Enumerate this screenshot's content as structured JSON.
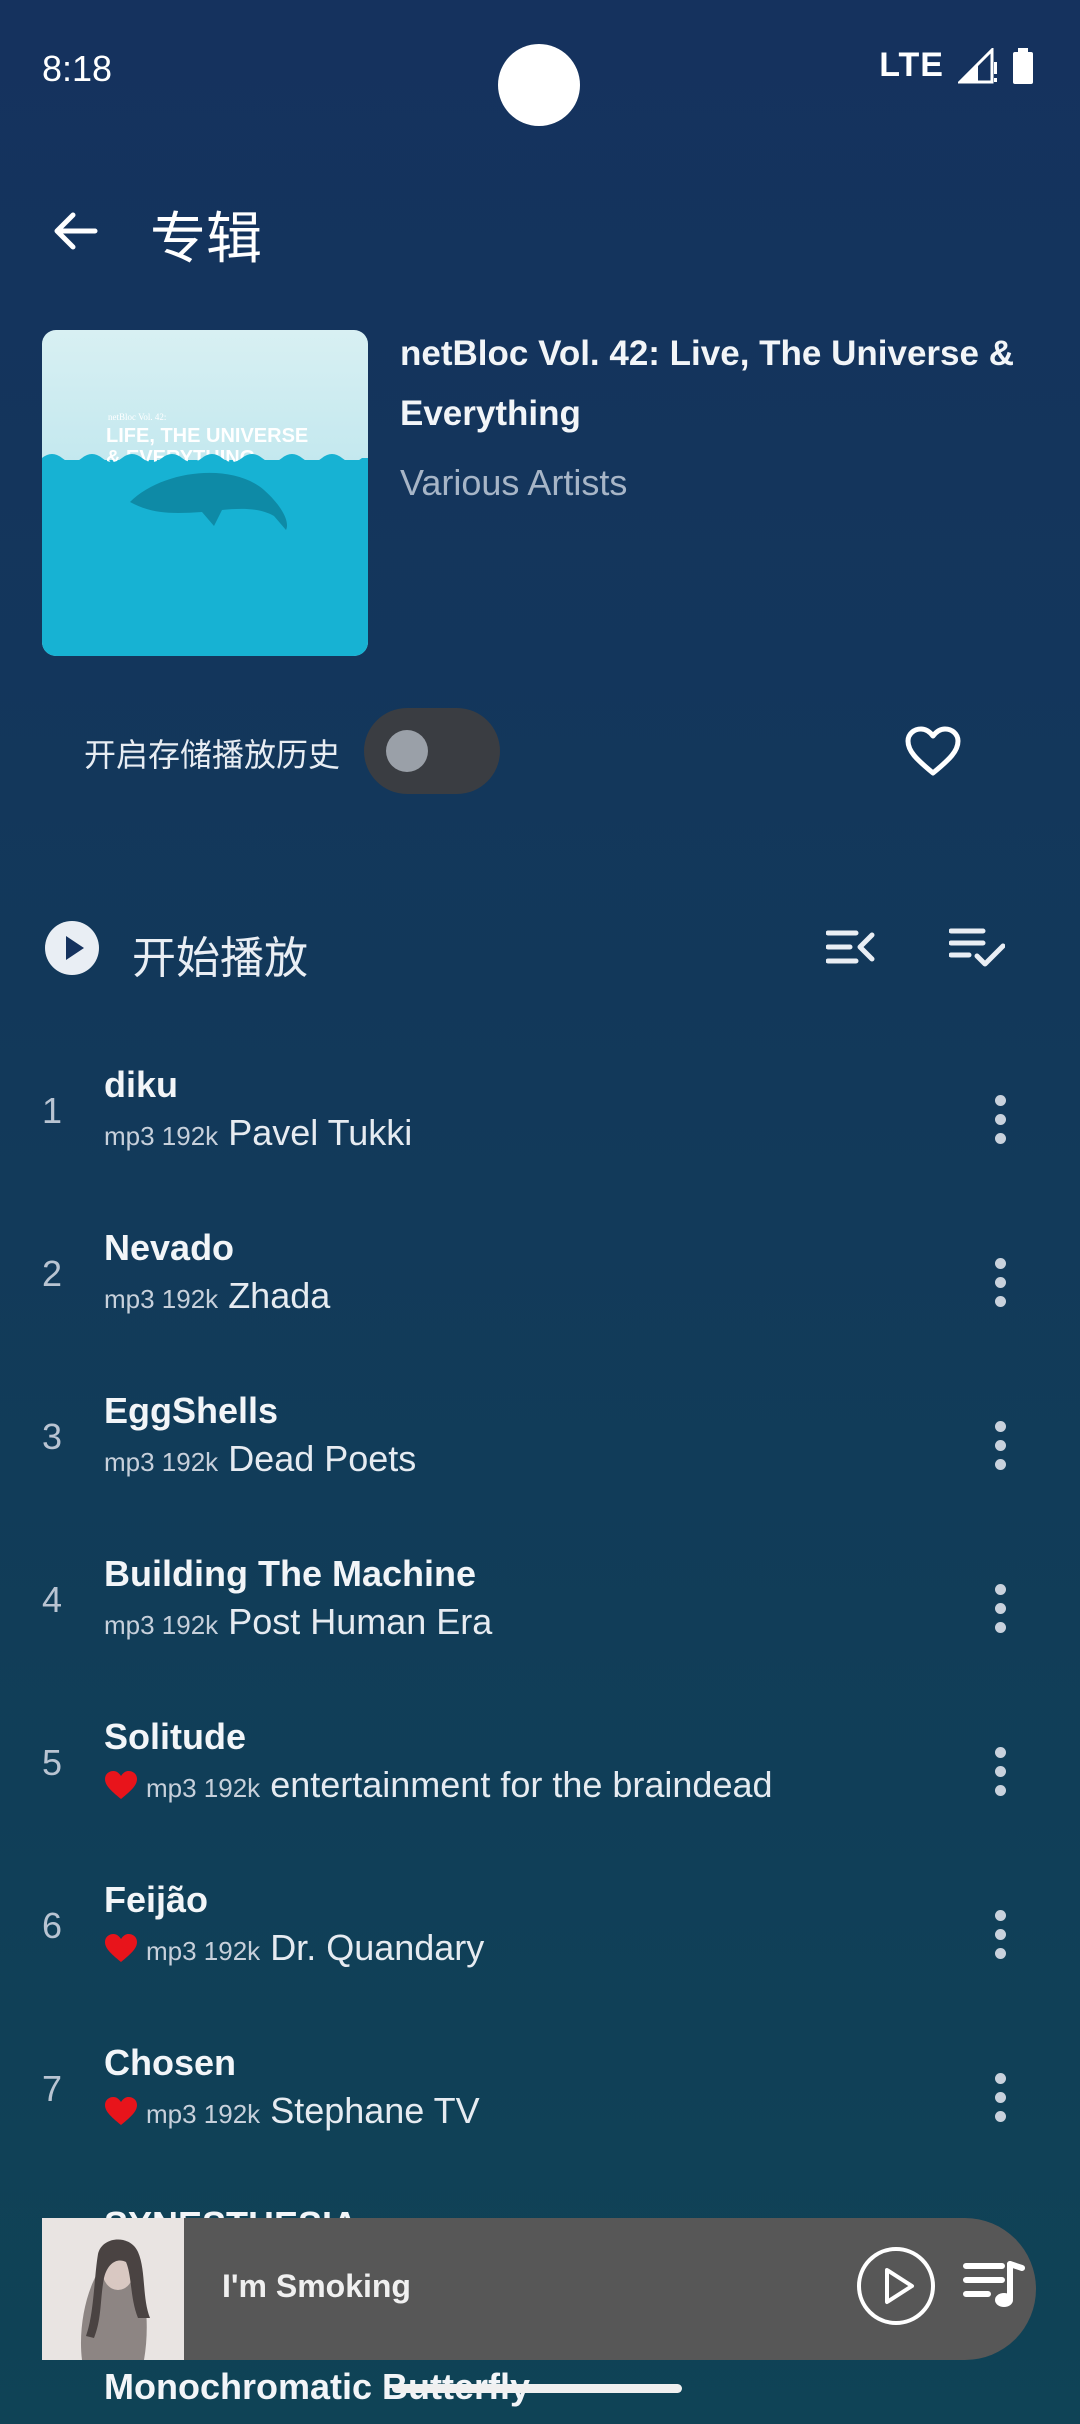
{
  "status_bar": {
    "time": "8:18",
    "network": "LTE"
  },
  "header": {
    "title": "专辑",
    "back_icon": "arrow-back-icon"
  },
  "album": {
    "title": "netBloc Vol. 42: Live, The Universe & Everything",
    "artist": "Various Artists",
    "cover": {
      "small_text": "netBloc Vol. 42:",
      "line1": "LIFE, THE UNIVERSE",
      "line2": "& EVERYTHING",
      "sky_color": "#bfe6ee",
      "sea_color": "#17b2d3"
    }
  },
  "history": {
    "label": "开启存储播放历史",
    "enabled": false
  },
  "actions": {
    "start_play_label": "开始播放"
  },
  "tracks": [
    {
      "number": "1",
      "title": "diku",
      "meta": "mp3 192k",
      "artist": "Pavel Tukki",
      "favorite": false
    },
    {
      "number": "2",
      "title": "Nevado",
      "meta": "mp3 192k",
      "artist": "Zhada",
      "favorite": false
    },
    {
      "number": "3",
      "title": "EggShells",
      "meta": "mp3 192k",
      "artist": "Dead Poets",
      "favorite": false
    },
    {
      "number": "4",
      "title": "Building The Machine",
      "meta": "mp3 192k",
      "artist": "Post Human Era",
      "favorite": false
    },
    {
      "number": "5",
      "title": "Solitude",
      "meta": "mp3 192k",
      "artist": "entertainment for the braindead",
      "favorite": true
    },
    {
      "number": "6",
      "title": "Feijão",
      "meta": "mp3 192k",
      "artist": "Dr. Quandary",
      "favorite": true
    },
    {
      "number": "7",
      "title": "Chosen",
      "meta": "mp3 192k",
      "artist": "Stephane TV",
      "favorite": true
    }
  ],
  "partial_tracks": {
    "next_title": "SYNESTHESIA",
    "after_title": "Monochromatic Butterfly"
  },
  "mini_player": {
    "title": "I'm Smoking"
  },
  "colors": {
    "heart": "#e8141b",
    "mini_player_bg": "#575757",
    "toggle_bg": "#3a3d42"
  }
}
